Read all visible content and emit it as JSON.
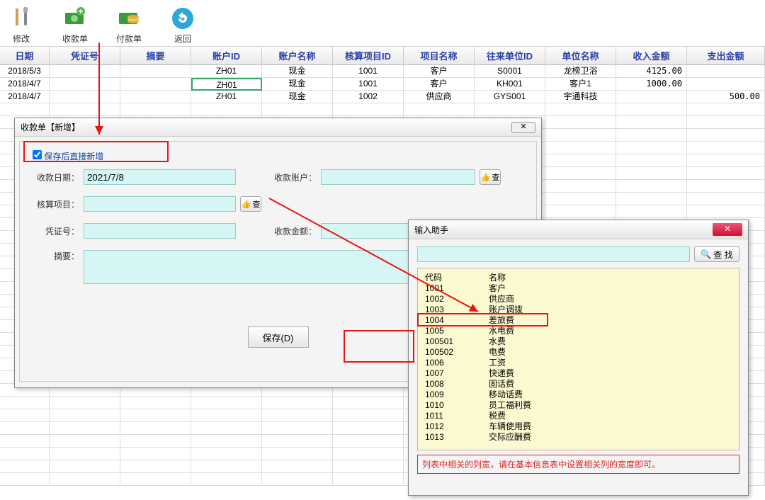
{
  "toolbar": [
    {
      "label": "修改"
    },
    {
      "label": "收款单"
    },
    {
      "label": "付款单"
    },
    {
      "label": "返回"
    }
  ],
  "headers": [
    "日期",
    "凭证号",
    "摘要",
    "账户ID",
    "账户名称",
    "核算项目ID",
    "项目名称",
    "往来单位ID",
    "单位名称",
    "收入金额",
    "支出金额"
  ],
  "rows": [
    {
      "date": "2018/5/3",
      "vno": "",
      "memo": "",
      "acct": "ZH01",
      "acctName": "现金",
      "cid": "1001",
      "cname": "客户",
      "uid": "S0001",
      "uname": "龙榜卫浴",
      "in": "4125.00",
      "out": ""
    },
    {
      "date": "2018/4/7",
      "vno": "",
      "memo": "",
      "acct": "ZH01",
      "acctName": "现金",
      "cid": "1001",
      "cname": "客户",
      "uid": "KH001",
      "uname": "客户1",
      "in": "1000.00",
      "out": "",
      "hl": true
    },
    {
      "date": "2018/4/7",
      "vno": "",
      "memo": "",
      "acct": "ZH01",
      "acctName": "现金",
      "cid": "1002",
      "cname": "供应商",
      "uid": "GYS001",
      "uname": "宇通科技",
      "in": "",
      "out": "500.00"
    }
  ],
  "dlg1": {
    "title": "收款单【新增】",
    "check": "保存后直接新增",
    "labels": {
      "date": "收款日期：",
      "acct": "收款账户：",
      "proj": "核算项目：",
      "vno": "凭证号：",
      "amt": "收款金额：",
      "memo": "摘要："
    },
    "dateVal": "2021/7/8",
    "look": "查",
    "save": "保存(D)"
  },
  "dlg2": {
    "title": "输入助手",
    "find": "查 找",
    "list": [
      {
        "code": "代码",
        "name": "名称"
      },
      {
        "code": "1001",
        "name": "客户"
      },
      {
        "code": "1002",
        "name": "供应商"
      },
      {
        "code": "1003",
        "name": "账户调拨"
      },
      {
        "code": "1004",
        "name": "差旅费"
      },
      {
        "code": "1005",
        "name": "水电费"
      },
      {
        "code": "100501",
        "name": "水费"
      },
      {
        "code": "100502",
        "name": "电费"
      },
      {
        "code": "1006",
        "name": "工资"
      },
      {
        "code": "1007",
        "name": "快递费"
      },
      {
        "code": "1008",
        "name": "固话费"
      },
      {
        "code": "1009",
        "name": "移动话费"
      },
      {
        "code": "1010",
        "name": "员工福利费"
      },
      {
        "code": "1011",
        "name": "税费"
      },
      {
        "code": "1012",
        "name": "车辆使用费"
      },
      {
        "code": "1013",
        "name": "交际应酬费"
      }
    ],
    "hint": "列表中相关的列宽，请在基本信息表中设置相关列的宽度即可。"
  }
}
